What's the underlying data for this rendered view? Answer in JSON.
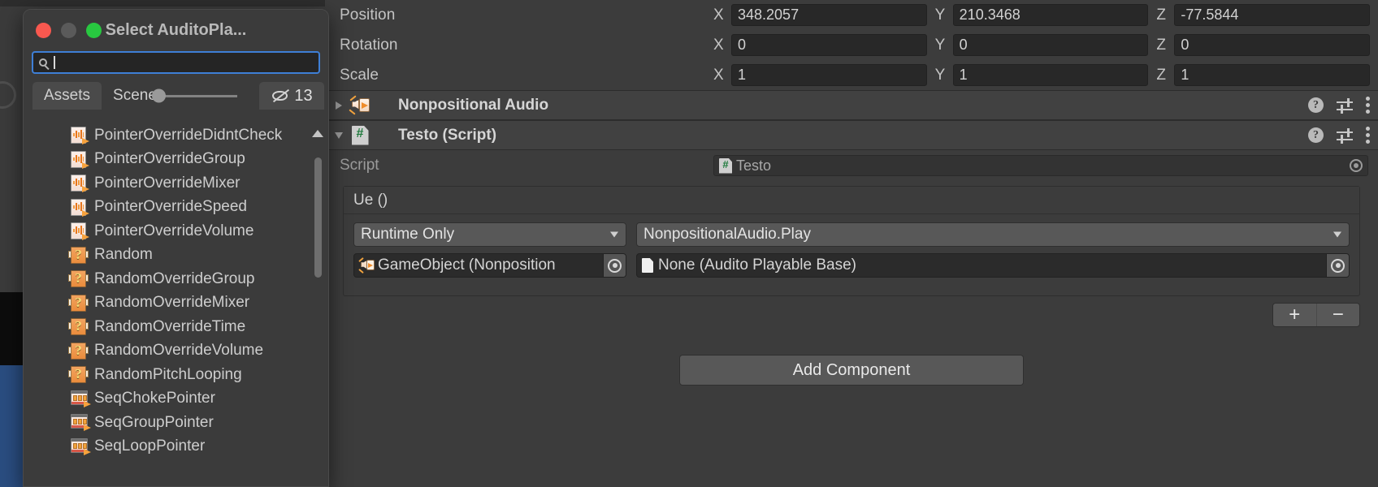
{
  "inspector": {
    "transform": {
      "rows": [
        {
          "label": "Position",
          "x": "348.2057",
          "y": "210.3468",
          "z": "-77.5844"
        },
        {
          "label": "Rotation",
          "x": "0",
          "y": "0",
          "z": "0"
        },
        {
          "label": "Scale",
          "x": "1",
          "y": "1",
          "z": "1"
        }
      ],
      "axis_labels": {
        "x": "X",
        "y": "Y",
        "z": "Z"
      }
    },
    "components": [
      {
        "title": "Nonpositional Audio",
        "icon": "nonpositional-audio-icon",
        "expanded": false
      },
      {
        "title": "Testo (Script)",
        "icon": "csharp-script-icon",
        "expanded": true
      }
    ],
    "script_row": {
      "label": "Script",
      "value": "Testo"
    },
    "unity_event": {
      "title": "Ue ()",
      "entries": [
        {
          "mode": "Runtime Only",
          "function": "NonpositionalAudio.Play",
          "target_object": "GameObject (Nonposition",
          "argument": "None (Audito Playable Base)"
        }
      ],
      "add_label": "+",
      "remove_label": "−"
    },
    "add_component_label": "Add Component",
    "header_icons": {
      "help": "?",
      "preset": "preset-icon",
      "menu": "kebab-menu-icon"
    }
  },
  "picker_window": {
    "title": "Select AuditoPla...",
    "traffic_lights": [
      "close",
      "minimize",
      "zoom"
    ],
    "search": {
      "value": "",
      "placeholder": ""
    },
    "tabs": [
      {
        "label": "Assets",
        "active": true
      },
      {
        "label": "Scene",
        "active": false
      }
    ],
    "zoom_slider": {
      "value": 0
    },
    "hidden_count": "13",
    "items": [
      {
        "label": "PointerOverrideDidntCheck",
        "icon": "audio-clip-icon"
      },
      {
        "label": "PointerOverrideGroup",
        "icon": "audio-clip-icon"
      },
      {
        "label": "PointerOverrideMixer",
        "icon": "audio-clip-icon"
      },
      {
        "label": "PointerOverrideSpeed",
        "icon": "audio-clip-icon"
      },
      {
        "label": "PointerOverrideVolume",
        "icon": "audio-clip-icon"
      },
      {
        "label": "Random",
        "icon": "question-prefab-icon"
      },
      {
        "label": "RandomOverrideGroup",
        "icon": "question-prefab-icon"
      },
      {
        "label": "RandomOverrideMixer",
        "icon": "question-prefab-icon"
      },
      {
        "label": "RandomOverrideTime",
        "icon": "question-prefab-icon"
      },
      {
        "label": "RandomOverrideVolume",
        "icon": "question-prefab-icon"
      },
      {
        "label": "RandomPitchLooping",
        "icon": "question-prefab-icon"
      },
      {
        "label": "SeqChokePointer",
        "icon": "sequence-icon"
      },
      {
        "label": "SeqGroupPointer",
        "icon": "sequence-icon"
      },
      {
        "label": "SeqLoopPointer",
        "icon": "sequence-icon"
      }
    ]
  },
  "colors": {
    "panel_bg": "#3c3c3c",
    "header_bg": "#414141",
    "field_bg": "#282828",
    "button_bg": "#585858",
    "accent_blue": "#3e7fd6",
    "close_red": "#f9584f",
    "zoom_green": "#28c840",
    "text": "#cdcdcd"
  }
}
